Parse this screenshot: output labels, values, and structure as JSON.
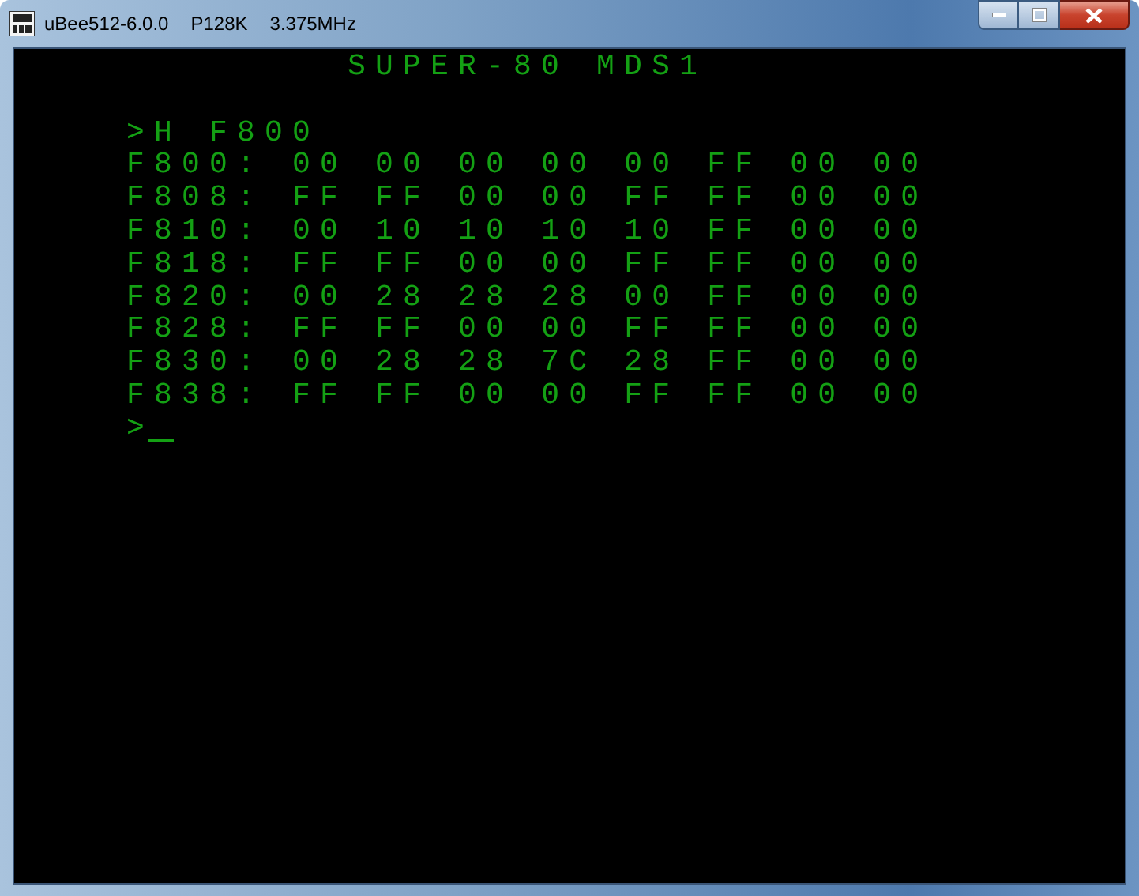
{
  "window": {
    "title": "uBee512-6.0.0",
    "model": "P128K",
    "clock": "3.375MHz"
  },
  "screen": {
    "header": "SUPER-80 MDS1",
    "command": ">H F800",
    "rows": [
      {
        "address": "F800:",
        "bytes": [
          "00",
          "00",
          "00",
          "00",
          "00",
          "FF",
          "00",
          "00"
        ]
      },
      {
        "address": "F808:",
        "bytes": [
          "FF",
          "FF",
          "00",
          "00",
          "FF",
          "FF",
          "00",
          "00"
        ]
      },
      {
        "address": "F810:",
        "bytes": [
          "00",
          "10",
          "10",
          "10",
          "10",
          "FF",
          "00",
          "00"
        ]
      },
      {
        "address": "F818:",
        "bytes": [
          "FF",
          "FF",
          "00",
          "00",
          "FF",
          "FF",
          "00",
          "00"
        ]
      },
      {
        "address": "F820:",
        "bytes": [
          "00",
          "28",
          "28",
          "28",
          "00",
          "FF",
          "00",
          "00"
        ]
      },
      {
        "address": "F828:",
        "bytes": [
          "FF",
          "FF",
          "00",
          "00",
          "FF",
          "FF",
          "00",
          "00"
        ]
      },
      {
        "address": "F830:",
        "bytes": [
          "00",
          "28",
          "28",
          "7C",
          "28",
          "FF",
          "00",
          "00"
        ]
      },
      {
        "address": "F838:",
        "bytes": [
          "FF",
          "FF",
          "00",
          "00",
          "FF",
          "FF",
          "00",
          "00"
        ]
      }
    ],
    "prompt": ">",
    "cursor": true
  }
}
